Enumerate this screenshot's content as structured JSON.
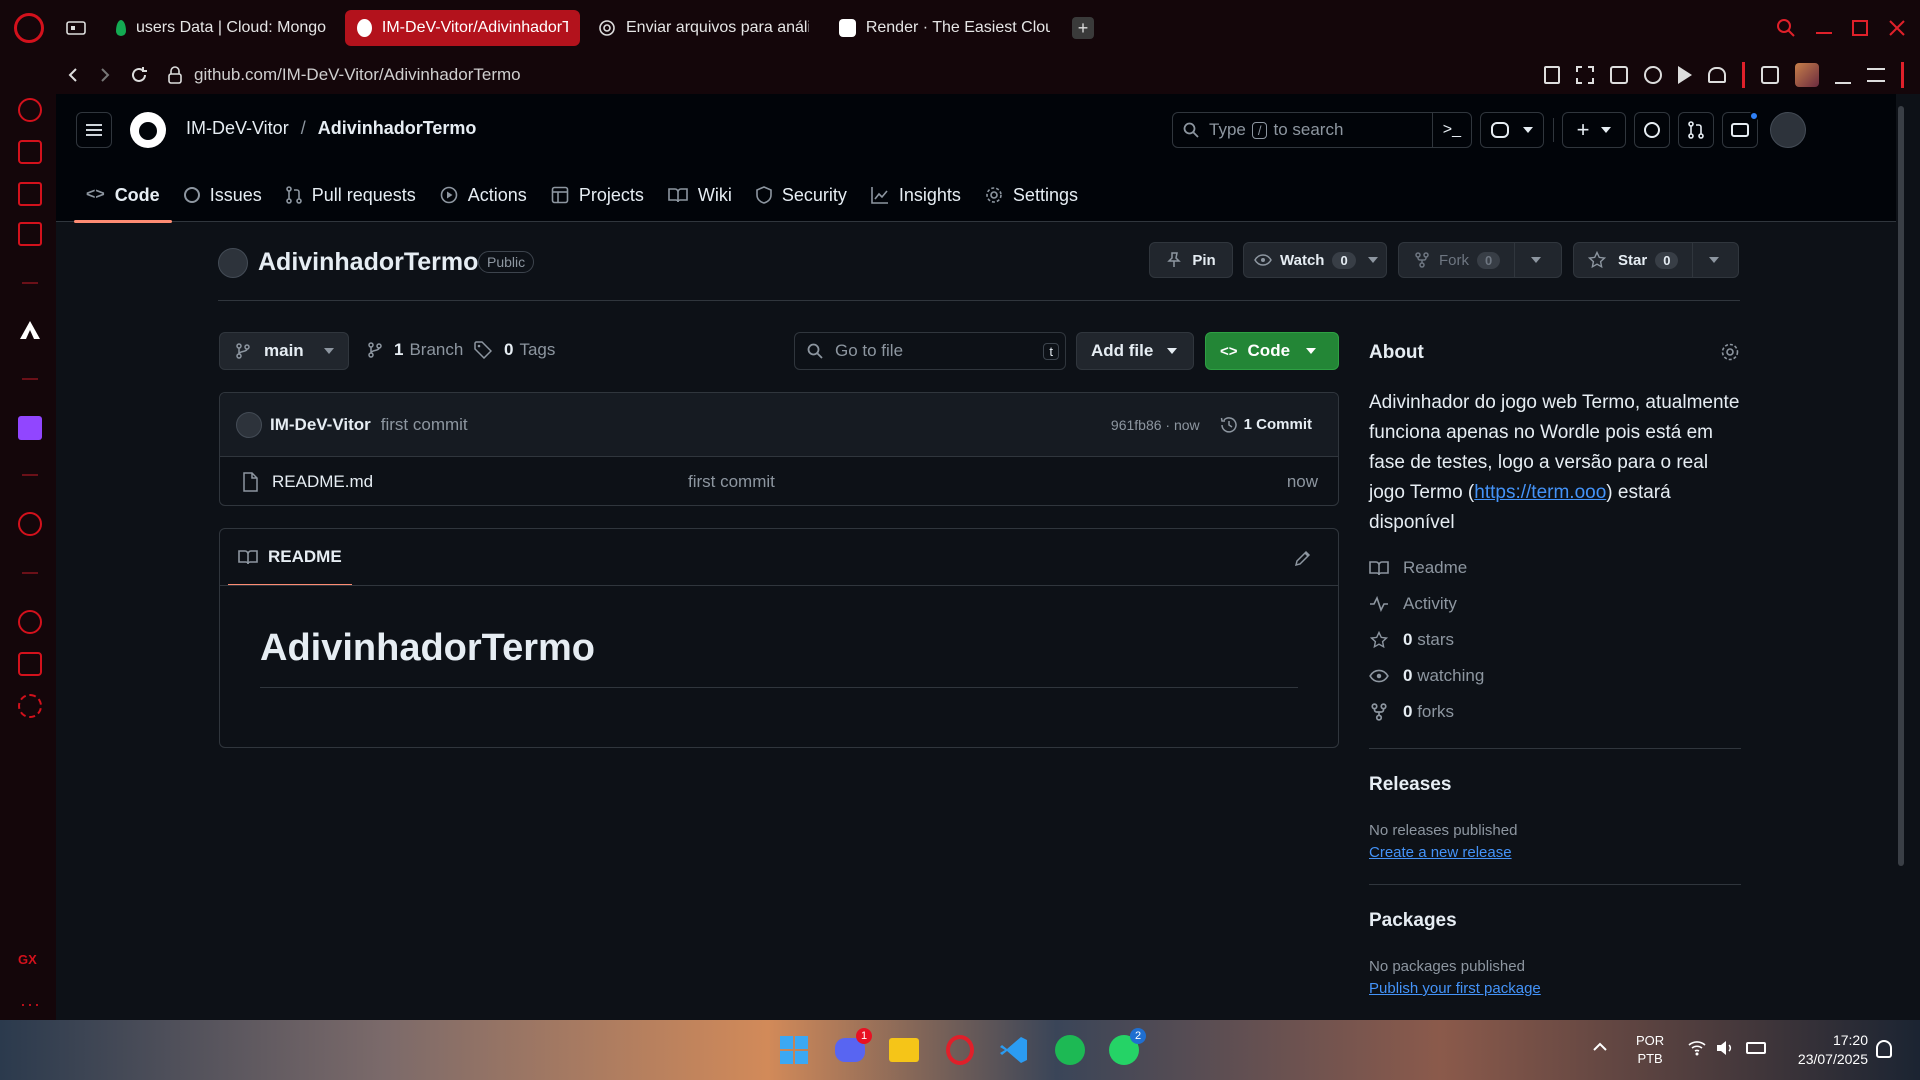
{
  "browser": {
    "tabs": [
      {
        "label": "users Data | Cloud: Mongo",
        "active": false
      },
      {
        "label": "IM-DeV-Vitor/AdivinhadorTermo",
        "active": true
      },
      {
        "label": "Enviar arquivos para análise",
        "active": false
      },
      {
        "label": "Render · The Easiest Cloud",
        "active": false
      }
    ],
    "url": "github.com/IM-DeV-Vitor/AdivinhadorTermo",
    "sidebar_label": "GX",
    "accent": "#b3121c"
  },
  "header": {
    "owner": "IM-DeV-Vitor",
    "separator": "/",
    "repo": "AdivinhadorTermo",
    "search_prefix": "Type",
    "search_key": "/",
    "search_suffix": "to search"
  },
  "repo_tabs": [
    "Code",
    "Issues",
    "Pull requests",
    "Actions",
    "Projects",
    "Wiki",
    "Security",
    "Insights",
    "Settings"
  ],
  "repo_title": {
    "name": "AdivinhadorTermo",
    "visibility": "Public",
    "pin": "Pin",
    "watch": "Watch",
    "watch_count": "0",
    "fork": "Fork",
    "fork_count": "0",
    "star": "Star",
    "star_count": "0"
  },
  "toolbar": {
    "branch": "main",
    "branch_count": "1",
    "branch_label": "Branch",
    "tag_count": "0",
    "tag_label": "Tags",
    "goto_placeholder": "Go to file",
    "goto_key": "t",
    "add_file": "Add file",
    "code": "Code",
    "code_color": "#238636"
  },
  "commit": {
    "author": "IM-DeV-Vitor",
    "message": "first commit",
    "hash_time": "961fb86 · now",
    "count": "1 Commit"
  },
  "files": [
    {
      "name": "README.md",
      "message": "first commit",
      "time": "now"
    }
  ],
  "readme": {
    "tab": "README",
    "heading": "AdivinhadorTermo"
  },
  "about": {
    "title": "About",
    "desc_before": "Adivinhador do jogo web Termo, atualmente funciona apenas no Wordle pois está em fase de testes, logo a versão para o real jogo Termo (",
    "desc_link": "https://term.ooo",
    "desc_after": ") estará disponível",
    "readme": "Readme",
    "activity": "Activity",
    "stars_count": "0",
    "stars_label": "stars",
    "watching_count": "0",
    "watching_label": "watching",
    "forks_count": "0",
    "forks_label": "forks"
  },
  "releases": {
    "title": "Releases",
    "none": "No releases published",
    "create": "Create a new release"
  },
  "packages": {
    "title": "Packages",
    "none": "No packages published",
    "publish": "Publish your first package"
  },
  "taskbar": {
    "lang_top": "POR",
    "lang_bottom": "PTB",
    "time": "17:20",
    "date": "23/07/2025",
    "discord_badge": "1",
    "whatsapp_badge": "2"
  }
}
